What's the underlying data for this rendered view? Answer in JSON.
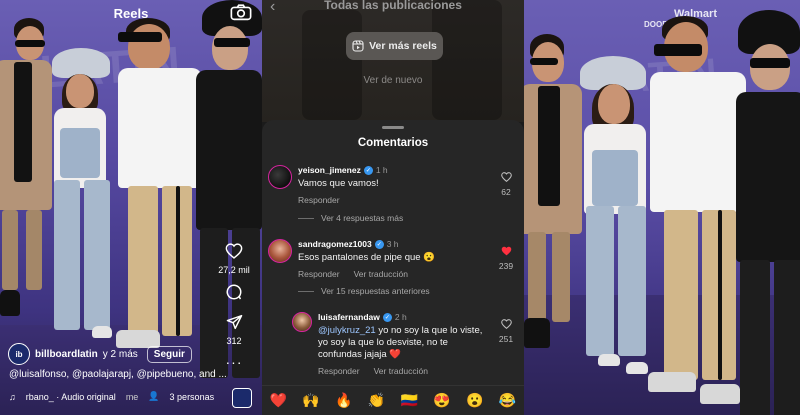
{
  "reels": {
    "title": "Reels",
    "likes_count": "27,2 mil",
    "shares_count": "312",
    "author": {
      "avatar_text": "ib",
      "username": "billboardlatin",
      "time": "y 2 más",
      "follow_label": "Seguir"
    },
    "caption": "@luisalfonso, @paolajarapj, @pipebueno, and ...",
    "audio_label": "rbano_ · Audio original",
    "audio_extra": "me",
    "people_label": "3 personas",
    "icons": {
      "camera": "camera-icon",
      "like": "heart-icon",
      "comment": "comment-icon",
      "share": "send-icon",
      "more": "more-icon",
      "music": "music-icon",
      "people": "person-icon"
    }
  },
  "comments_panel": {
    "top_title": "Todas las publicaciones",
    "more_reels_label": "Ver más reels",
    "see_again_label": "Ver de nuevo",
    "sheet_title": "Comentarios",
    "comments": [
      {
        "username": "yeison_jimenez",
        "time": "1 h",
        "text": "Vamos que vamos!",
        "reply_label": "Responder",
        "likes": "62",
        "liked": false
      },
      {
        "username": "sandragomez1003",
        "time": "3 h",
        "text": "Esos pantalones de pipe que 😮",
        "reply_label": "Responder",
        "translate_label": "Ver traducción",
        "likes": "239",
        "liked": true
      },
      {
        "username": "luisafernandaw",
        "time": "2 h",
        "mention": "@julykruz_21",
        "text": " yo no soy la que lo viste, yo soy la que lo desviste, no te confundas jajaja ❤️",
        "reply_label": "Responder",
        "translate_label": "Ver traducción",
        "likes": "251",
        "liked": false
      }
    ],
    "more_replies_1": "Ver 4 respuestas más",
    "more_replies_2": "Ver 15 respuestas anteriores",
    "emojis": [
      "❤️",
      "🙌",
      "🔥",
      "👏",
      "🇨🇴",
      "😍",
      "😮",
      "😂"
    ],
    "colors": {
      "sheet_bg": "#262626",
      "liked_heart": "#ff3040",
      "verified": "#3897f0"
    }
  },
  "photo_panel": {
    "sponsor_walmart": "Walmart",
    "sponsor_doordash": "DOORDASH"
  }
}
